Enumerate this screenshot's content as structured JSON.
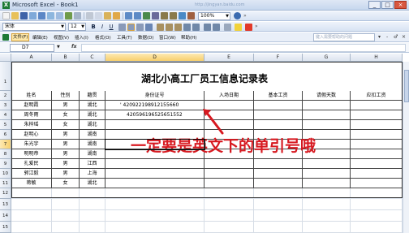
{
  "window": {
    "title": "Microsoft Excel - Book1",
    "watermark_url": "http://jingyan.baidu.com",
    "buttons": [
      "_",
      "□",
      "×"
    ]
  },
  "toolbar": {
    "font_name": "宋体",
    "font_size": "12",
    "zoom": "100%",
    "bold": "B",
    "italic": "I",
    "underline": "U"
  },
  "menu": {
    "items": [
      "文件(F)",
      "编辑(E)",
      "视图(V)",
      "插入(I)",
      "格式(O)",
      "工具(T)",
      "数据(D)",
      "窗口(W)",
      "帮助(H)"
    ],
    "help_placeholder": "键入需要帮助的问题",
    "controls": [
      "▾",
      "-",
      "♂",
      "×"
    ]
  },
  "formula_bar": {
    "name_box": "D7",
    "fx": "fx",
    "content": ""
  },
  "sheet": {
    "columns": [
      "A",
      "B",
      "C",
      "D",
      "E",
      "F",
      "G",
      "H"
    ],
    "rows": [
      "1",
      "2",
      "3",
      "4",
      "5",
      "6",
      "7",
      "8",
      "9",
      "10",
      "11",
      "12",
      "13",
      "14",
      "15"
    ],
    "title": "湖北小高工厂员工信息记录表",
    "headers": [
      "姓名",
      "性别",
      "籍贯",
      "身份证号",
      "入场日期",
      "基本工资",
      "请假天数",
      "应扣工资"
    ],
    "data": [
      [
        "赵明霞",
        "男",
        "湖北",
        "' 420922198912155660"
      ],
      [
        "周冬雨",
        "女",
        "湖北",
        "420596196525651552"
      ],
      [
        "朱梓瑶",
        "女",
        "湖北",
        ""
      ],
      [
        "赵明心",
        "男",
        "湖南",
        ""
      ],
      [
        "朱光宇",
        "男",
        "湖南",
        ""
      ],
      [
        "明明帝",
        "男",
        "湖南",
        ""
      ],
      [
        "扎爱民",
        "男",
        "江西",
        ""
      ],
      [
        "郭江毅",
        "男",
        "上海",
        ""
      ],
      [
        "蒋敏",
        "女",
        "湖北",
        ""
      ]
    ]
  },
  "annotation": {
    "text": "一定要是英文下的单引号哦",
    "color": "#d71920"
  }
}
